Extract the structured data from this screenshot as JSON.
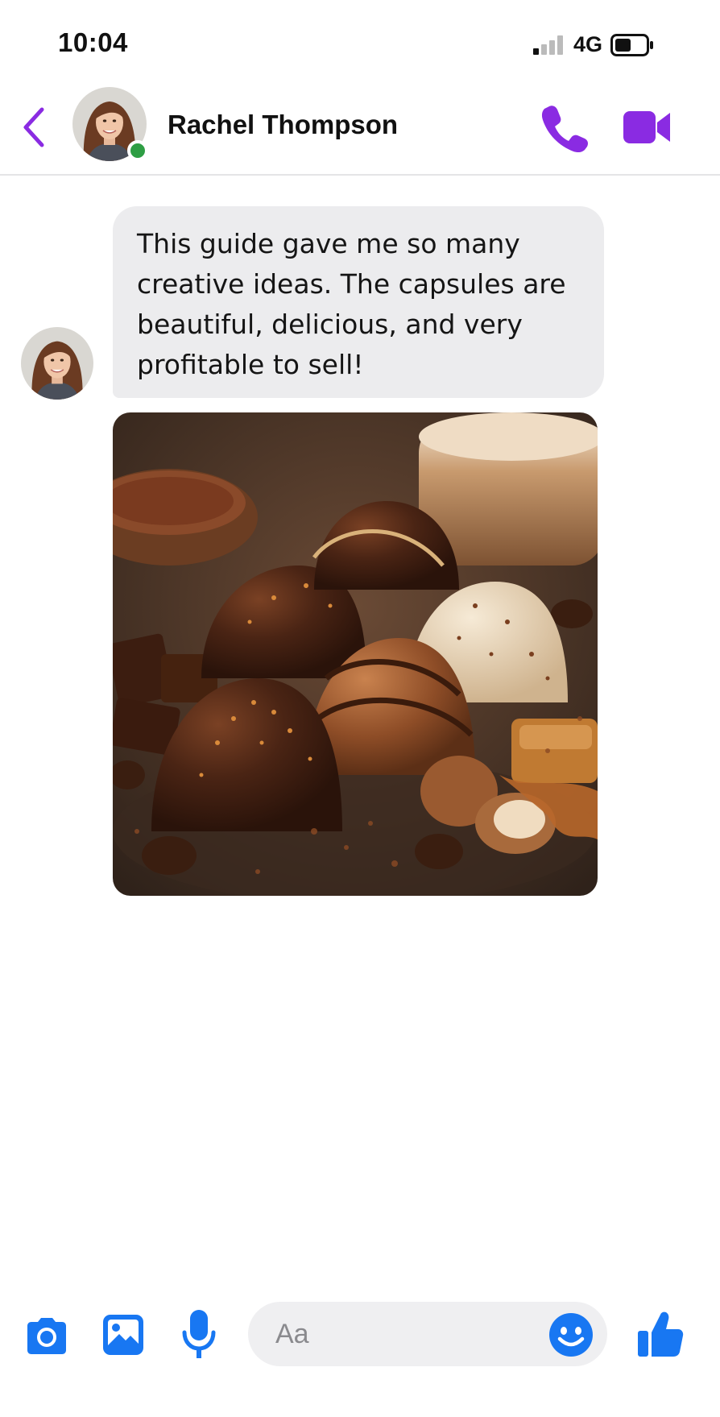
{
  "status_bar": {
    "time": "10:04",
    "network": "4G",
    "icons": [
      "signal-icon",
      "battery-icon"
    ]
  },
  "header": {
    "contact_name": "Rachel Thompson",
    "online": true,
    "icons": [
      "back-icon",
      "phone-icon",
      "video-camera-icon"
    ]
  },
  "conversation": {
    "messages": [
      {
        "type": "text",
        "text": "This guide gave me so many creative ideas. The capsules are beautiful, delicious, and very profitable to sell!"
      },
      {
        "type": "image",
        "icon": "chocolate-photo"
      }
    ]
  },
  "composer": {
    "placeholder": "Aa",
    "value": "",
    "icons": [
      "camera-icon",
      "gallery-icon",
      "microphone-icon",
      "emoji-icon",
      "thumbs-up-icon"
    ]
  },
  "colors": {
    "header_accent": "#8a2be2",
    "composer_accent": "#1877f2",
    "online_dot": "#2e9e44",
    "bubble_bg": "#ececee"
  }
}
